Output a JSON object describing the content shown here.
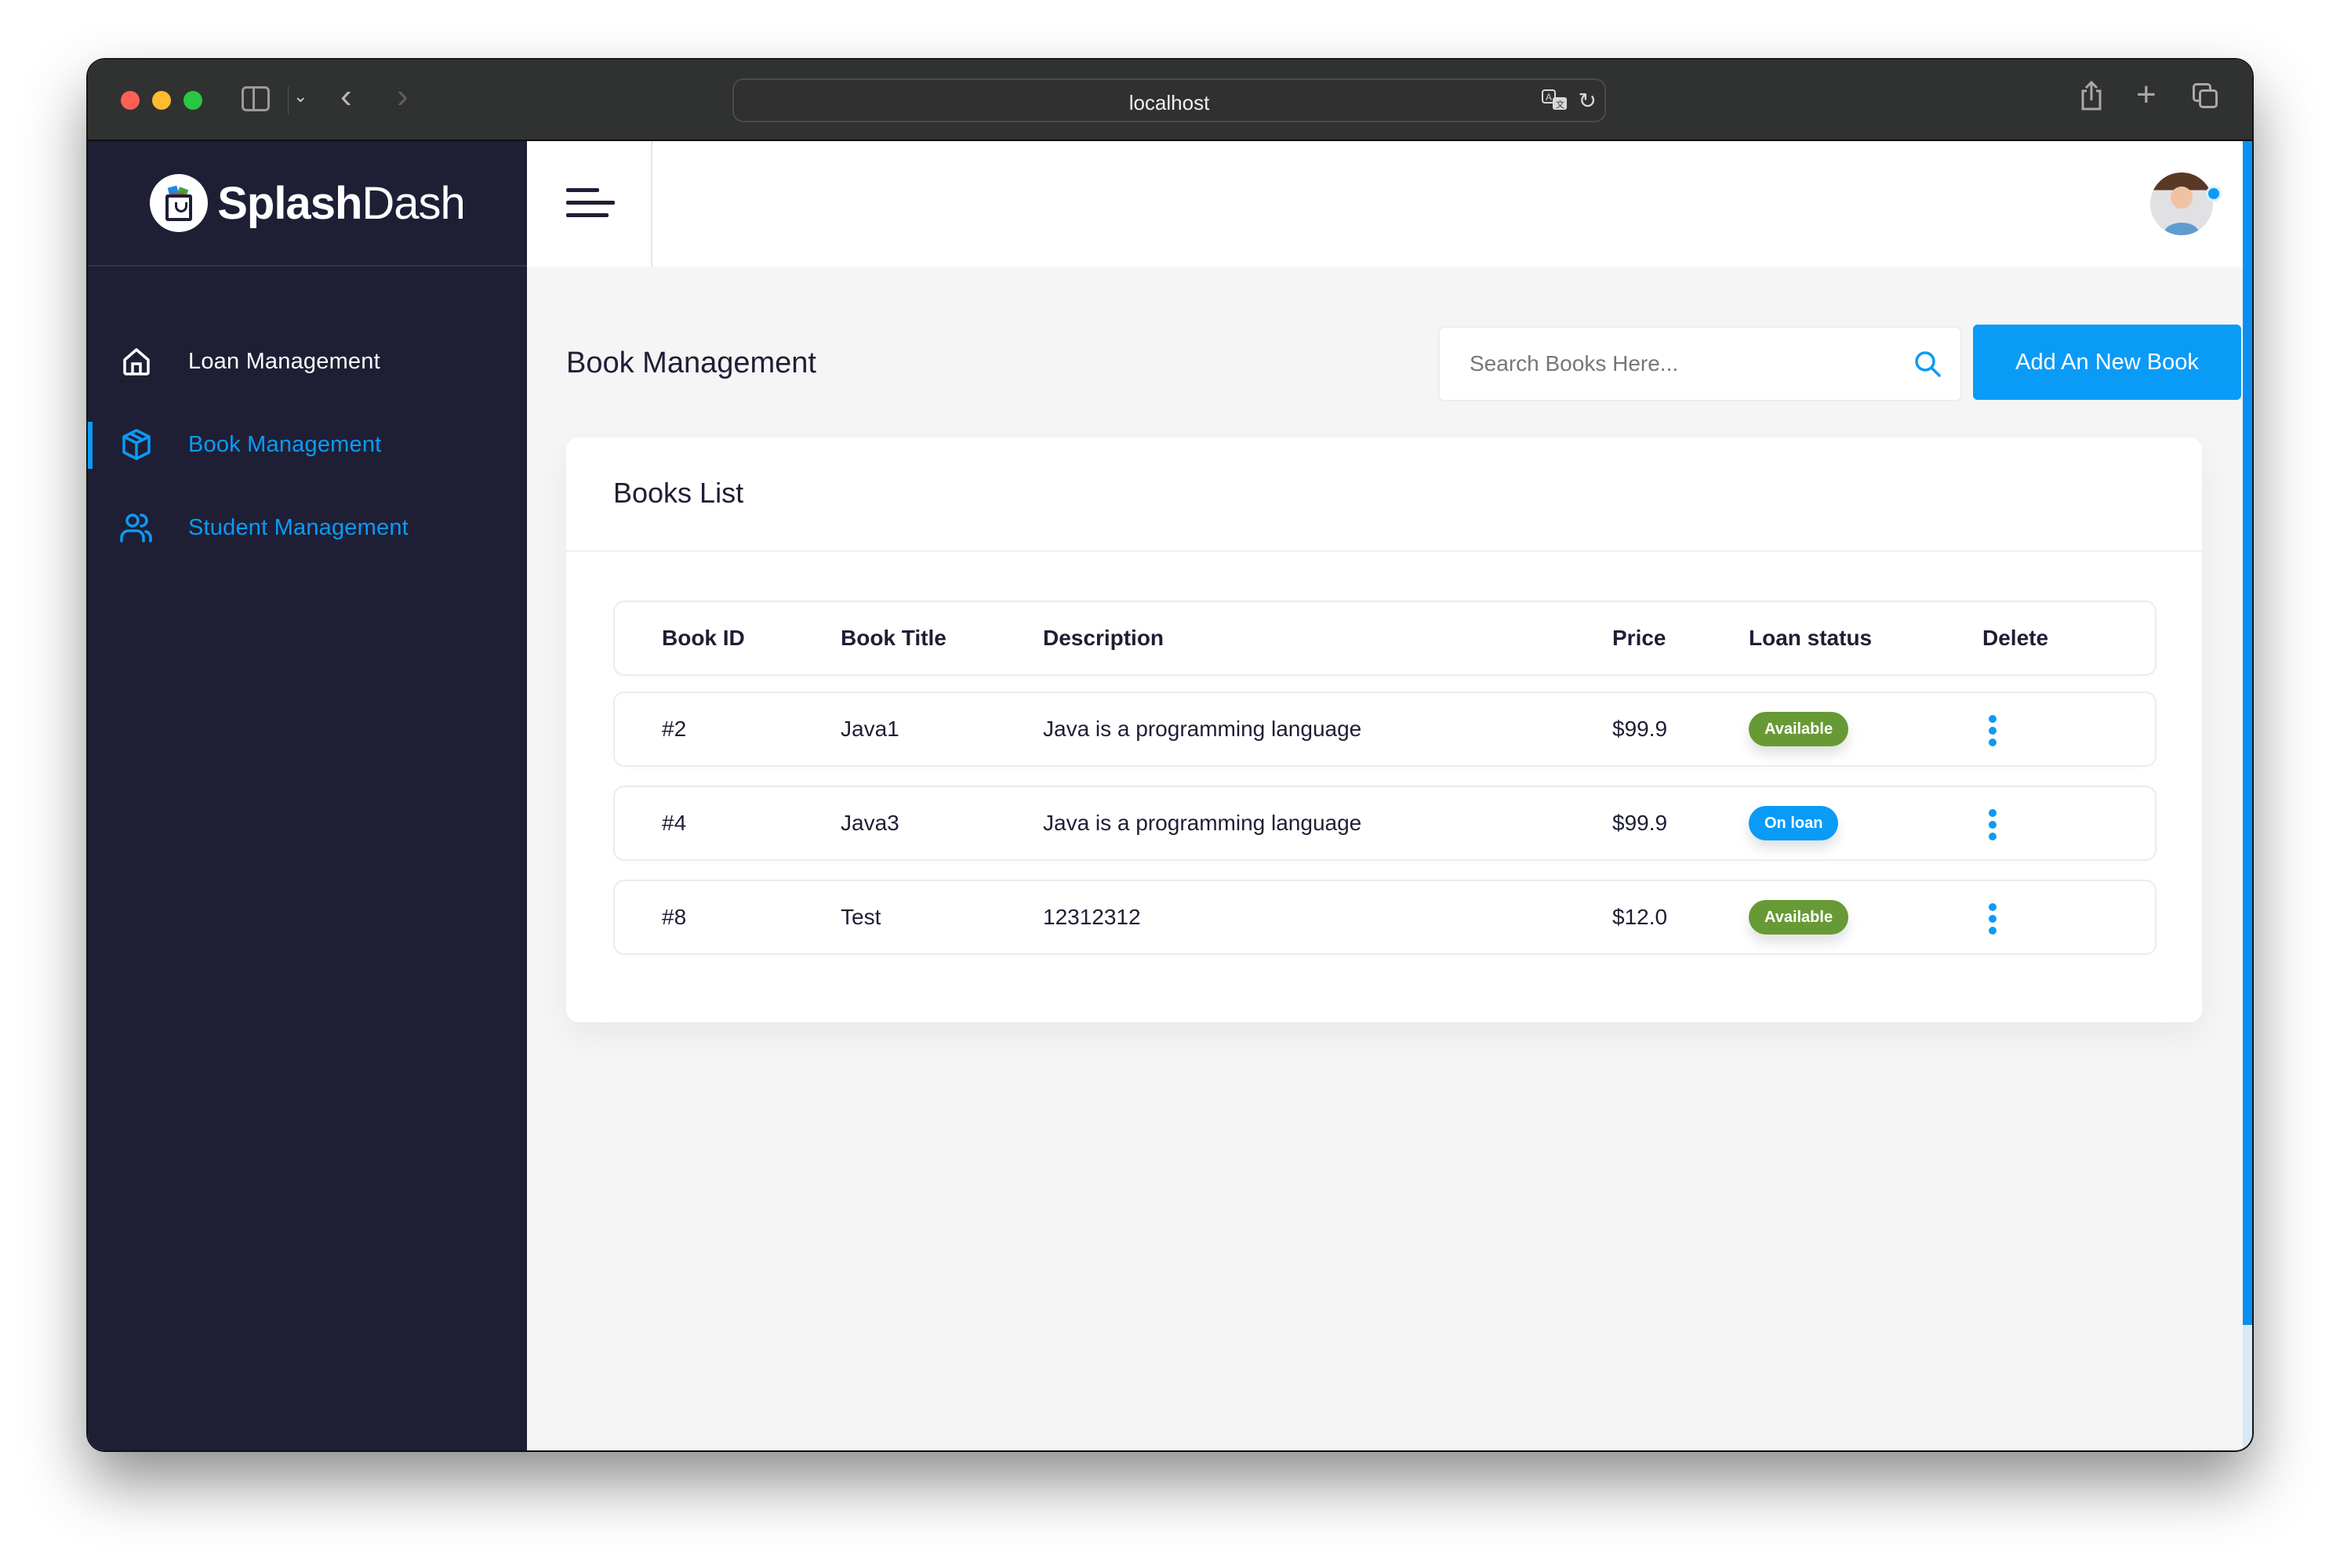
{
  "browser": {
    "url": "localhost",
    "icons": [
      "sidebar-toggle-icon",
      "chevron-down-icon",
      "back-icon",
      "forward-icon",
      "translate-icon",
      "reload-icon",
      "share-icon",
      "new-tab-icon",
      "tab-overview-icon"
    ],
    "glyphs": {
      "back": "‹",
      "forward": "›",
      "chevron": "⌄",
      "translate": "🗨",
      "reload": "↻",
      "share": "⇪",
      "plus": "+"
    }
  },
  "brand": {
    "name_bold": "Splash",
    "name_light": "Dash"
  },
  "sidebar": {
    "items": [
      {
        "label": "Loan Management",
        "icon": "home-icon",
        "active": false
      },
      {
        "label": "Book Management",
        "icon": "box-icon",
        "active": true
      },
      {
        "label": "Student Management",
        "icon": "users-icon",
        "active": false
      }
    ]
  },
  "header": {
    "menu_icon": "hamburger-icon",
    "avatar": "user-avatar",
    "status_color": "#0a9bf7"
  },
  "page": {
    "title": "Book Management",
    "search": {
      "placeholder": "Search Books Here...",
      "value": ""
    },
    "add_button_label": "Add An New Book"
  },
  "books_card": {
    "title": "Books List",
    "columns": [
      "Book ID",
      "Book Title",
      "Description",
      "Price",
      "Loan status",
      "Delete"
    ],
    "rows": [
      {
        "id": "#2",
        "title": "Java1",
        "description": "Java is a programming language",
        "price": "$99.9",
        "status": "Available",
        "status_kind": "available"
      },
      {
        "id": "#4",
        "title": "Java3",
        "description": "Java is a programming language",
        "price": "$99.9",
        "status": "On loan",
        "status_kind": "onloan"
      },
      {
        "id": "#8",
        "title": "Test",
        "description": "12312312",
        "price": "$12.0",
        "status": "Available",
        "status_kind": "available"
      }
    ]
  },
  "colors": {
    "accent": "#0a9bf7",
    "sidebar_bg": "#1e1f35",
    "available": "#679a34",
    "on_loan": "#0a9bf7",
    "page_bg": "#f5f5f5"
  }
}
